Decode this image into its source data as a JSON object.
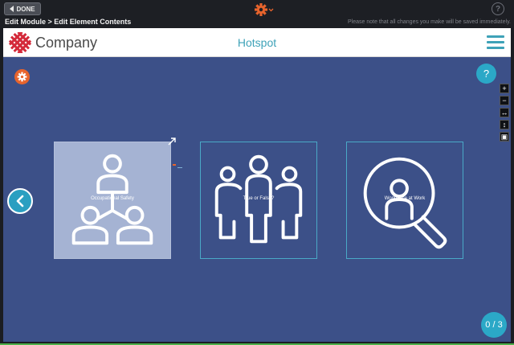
{
  "topbar": {
    "done_label": "DONE",
    "settings_icon": "gear-icon",
    "help_label": "?"
  },
  "breadcrumb": {
    "path": "Edit Module > Edit Element Contents",
    "note": "Please note that all changes you make will be saved immediately."
  },
  "header": {
    "company": "Company",
    "title": "Hotspot",
    "menu_icon": "hamburger-icon"
  },
  "stage": {
    "help_label": "?",
    "tools": [
      "+",
      "−",
      "↔",
      "↕",
      "▣"
    ],
    "counter": "0 / 3",
    "cards": [
      {
        "label": "Occupational Safety",
        "icon": "team-hierarchy-icon",
        "selected": true
      },
      {
        "label": "True or False?",
        "icon": "group-people-icon",
        "selected": false
      },
      {
        "label": "Workplace at Work",
        "icon": "person-search-icon",
        "selected": false
      }
    ]
  },
  "colors": {
    "accent": "#2ba8c7",
    "stage_bg": "#3c5088",
    "gear": "#e8642c",
    "logo": "#d42a3a",
    "selected_card": "#a5b3d3"
  }
}
